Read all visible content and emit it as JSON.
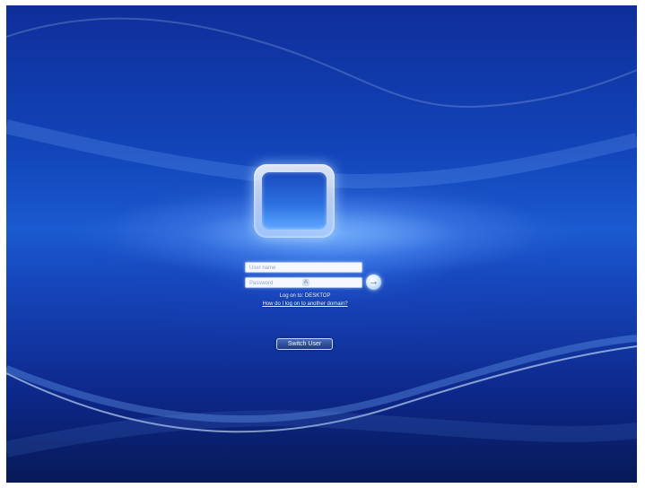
{
  "login": {
    "username_placeholder": "User name",
    "password_placeholder": "Password",
    "caps_lock_icon_text": "A",
    "logon_domain_text": "Log on to: DESKTOP",
    "other_domain_link": "How do I log on to another domain?",
    "switch_user_label": "Switch User",
    "submit_icon": "arrow-right-icon",
    "submit_icon_text": "→"
  }
}
